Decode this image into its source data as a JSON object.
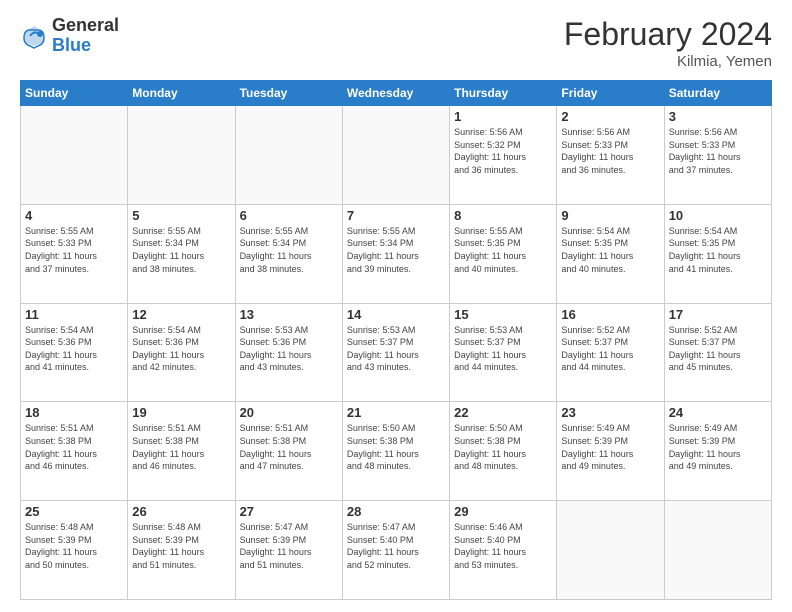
{
  "header": {
    "logo": {
      "general": "General",
      "blue": "Blue"
    },
    "title": "February 2024",
    "location": "Kilmia, Yemen"
  },
  "days_of_week": [
    "Sunday",
    "Monday",
    "Tuesday",
    "Wednesday",
    "Thursday",
    "Friday",
    "Saturday"
  ],
  "weeks": [
    [
      {
        "day": "",
        "info": ""
      },
      {
        "day": "",
        "info": ""
      },
      {
        "day": "",
        "info": ""
      },
      {
        "day": "",
        "info": ""
      },
      {
        "day": "1",
        "info": "Sunrise: 5:56 AM\nSunset: 5:32 PM\nDaylight: 11 hours\nand 36 minutes."
      },
      {
        "day": "2",
        "info": "Sunrise: 5:56 AM\nSunset: 5:33 PM\nDaylight: 11 hours\nand 36 minutes."
      },
      {
        "day": "3",
        "info": "Sunrise: 5:56 AM\nSunset: 5:33 PM\nDaylight: 11 hours\nand 37 minutes."
      }
    ],
    [
      {
        "day": "4",
        "info": "Sunrise: 5:55 AM\nSunset: 5:33 PM\nDaylight: 11 hours\nand 37 minutes."
      },
      {
        "day": "5",
        "info": "Sunrise: 5:55 AM\nSunset: 5:34 PM\nDaylight: 11 hours\nand 38 minutes."
      },
      {
        "day": "6",
        "info": "Sunrise: 5:55 AM\nSunset: 5:34 PM\nDaylight: 11 hours\nand 38 minutes."
      },
      {
        "day": "7",
        "info": "Sunrise: 5:55 AM\nSunset: 5:34 PM\nDaylight: 11 hours\nand 39 minutes."
      },
      {
        "day": "8",
        "info": "Sunrise: 5:55 AM\nSunset: 5:35 PM\nDaylight: 11 hours\nand 40 minutes."
      },
      {
        "day": "9",
        "info": "Sunrise: 5:54 AM\nSunset: 5:35 PM\nDaylight: 11 hours\nand 40 minutes."
      },
      {
        "day": "10",
        "info": "Sunrise: 5:54 AM\nSunset: 5:35 PM\nDaylight: 11 hours\nand 41 minutes."
      }
    ],
    [
      {
        "day": "11",
        "info": "Sunrise: 5:54 AM\nSunset: 5:36 PM\nDaylight: 11 hours\nand 41 minutes."
      },
      {
        "day": "12",
        "info": "Sunrise: 5:54 AM\nSunset: 5:36 PM\nDaylight: 11 hours\nand 42 minutes."
      },
      {
        "day": "13",
        "info": "Sunrise: 5:53 AM\nSunset: 5:36 PM\nDaylight: 11 hours\nand 43 minutes."
      },
      {
        "day": "14",
        "info": "Sunrise: 5:53 AM\nSunset: 5:37 PM\nDaylight: 11 hours\nand 43 minutes."
      },
      {
        "day": "15",
        "info": "Sunrise: 5:53 AM\nSunset: 5:37 PM\nDaylight: 11 hours\nand 44 minutes."
      },
      {
        "day": "16",
        "info": "Sunrise: 5:52 AM\nSunset: 5:37 PM\nDaylight: 11 hours\nand 44 minutes."
      },
      {
        "day": "17",
        "info": "Sunrise: 5:52 AM\nSunset: 5:37 PM\nDaylight: 11 hours\nand 45 minutes."
      }
    ],
    [
      {
        "day": "18",
        "info": "Sunrise: 5:51 AM\nSunset: 5:38 PM\nDaylight: 11 hours\nand 46 minutes."
      },
      {
        "day": "19",
        "info": "Sunrise: 5:51 AM\nSunset: 5:38 PM\nDaylight: 11 hours\nand 46 minutes."
      },
      {
        "day": "20",
        "info": "Sunrise: 5:51 AM\nSunset: 5:38 PM\nDaylight: 11 hours\nand 47 minutes."
      },
      {
        "day": "21",
        "info": "Sunrise: 5:50 AM\nSunset: 5:38 PM\nDaylight: 11 hours\nand 48 minutes."
      },
      {
        "day": "22",
        "info": "Sunrise: 5:50 AM\nSunset: 5:38 PM\nDaylight: 11 hours\nand 48 minutes."
      },
      {
        "day": "23",
        "info": "Sunrise: 5:49 AM\nSunset: 5:39 PM\nDaylight: 11 hours\nand 49 minutes."
      },
      {
        "day": "24",
        "info": "Sunrise: 5:49 AM\nSunset: 5:39 PM\nDaylight: 11 hours\nand 49 minutes."
      }
    ],
    [
      {
        "day": "25",
        "info": "Sunrise: 5:48 AM\nSunset: 5:39 PM\nDaylight: 11 hours\nand 50 minutes."
      },
      {
        "day": "26",
        "info": "Sunrise: 5:48 AM\nSunset: 5:39 PM\nDaylight: 11 hours\nand 51 minutes."
      },
      {
        "day": "27",
        "info": "Sunrise: 5:47 AM\nSunset: 5:39 PM\nDaylight: 11 hours\nand 51 minutes."
      },
      {
        "day": "28",
        "info": "Sunrise: 5:47 AM\nSunset: 5:40 PM\nDaylight: 11 hours\nand 52 minutes."
      },
      {
        "day": "29",
        "info": "Sunrise: 5:46 AM\nSunset: 5:40 PM\nDaylight: 11 hours\nand 53 minutes."
      },
      {
        "day": "",
        "info": ""
      },
      {
        "day": "",
        "info": ""
      }
    ]
  ]
}
